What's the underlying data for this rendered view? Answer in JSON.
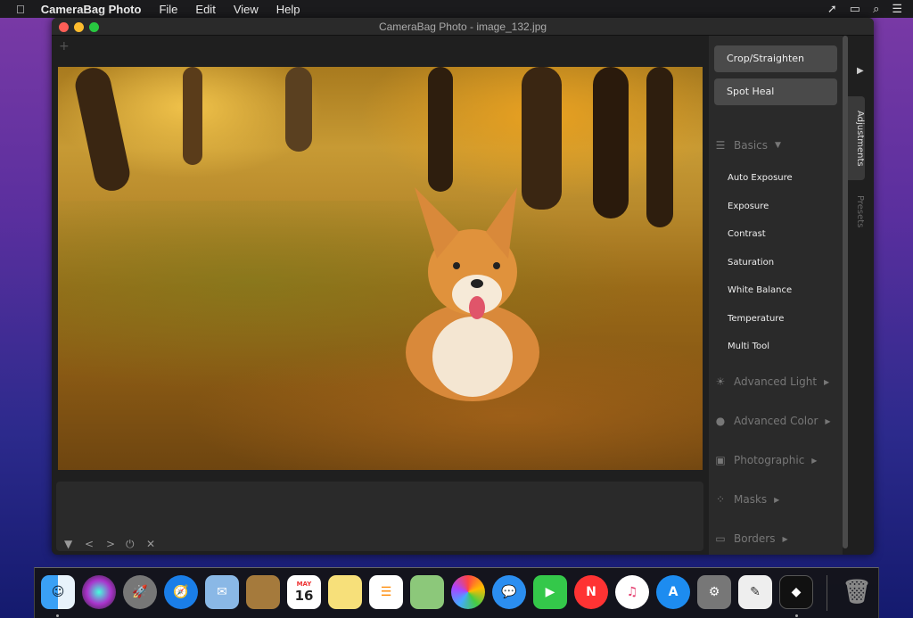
{
  "menubar": {
    "app": "CameraBag Photo",
    "items": [
      "File",
      "Edit",
      "View",
      "Help"
    ],
    "status_icons": [
      "cursor-icon",
      "display-icon",
      "search-icon",
      "list-icon"
    ]
  },
  "window": {
    "title": "CameraBag Photo - image_132.jpg",
    "add_label": "+"
  },
  "tools": {
    "crop": "Crop/Straighten",
    "spot_heal": "Spot Heal"
  },
  "sections": {
    "basics": "Basics",
    "basics_items": [
      "Auto Exposure",
      "Exposure",
      "Contrast",
      "Saturation",
      "White Balance",
      "Temperature",
      "Multi Tool"
    ],
    "advanced_light": "Advanced Light",
    "advanced_color": "Advanced Color",
    "photographic": "Photographic",
    "masks": "Masks",
    "borders": "Borders"
  },
  "tabs": {
    "adjustments": "Adjustments",
    "presets": "Presets"
  },
  "bottom_controls": [
    "collapse",
    "previous",
    "next",
    "reset",
    "close"
  ],
  "dock": {
    "apps": [
      "Finder",
      "Siri",
      "Launchpad",
      "Safari",
      "Mail",
      "Contacts",
      "Calendar",
      "Notes",
      "Reminders",
      "Maps",
      "Photos",
      "Messages",
      "FaceTime",
      "News",
      "iTunes",
      "App Store",
      "System Preferences",
      "TextEdit",
      "CameraBag Photo",
      "Trash"
    ],
    "calendar_month": "MAY",
    "calendar_day": "16"
  }
}
